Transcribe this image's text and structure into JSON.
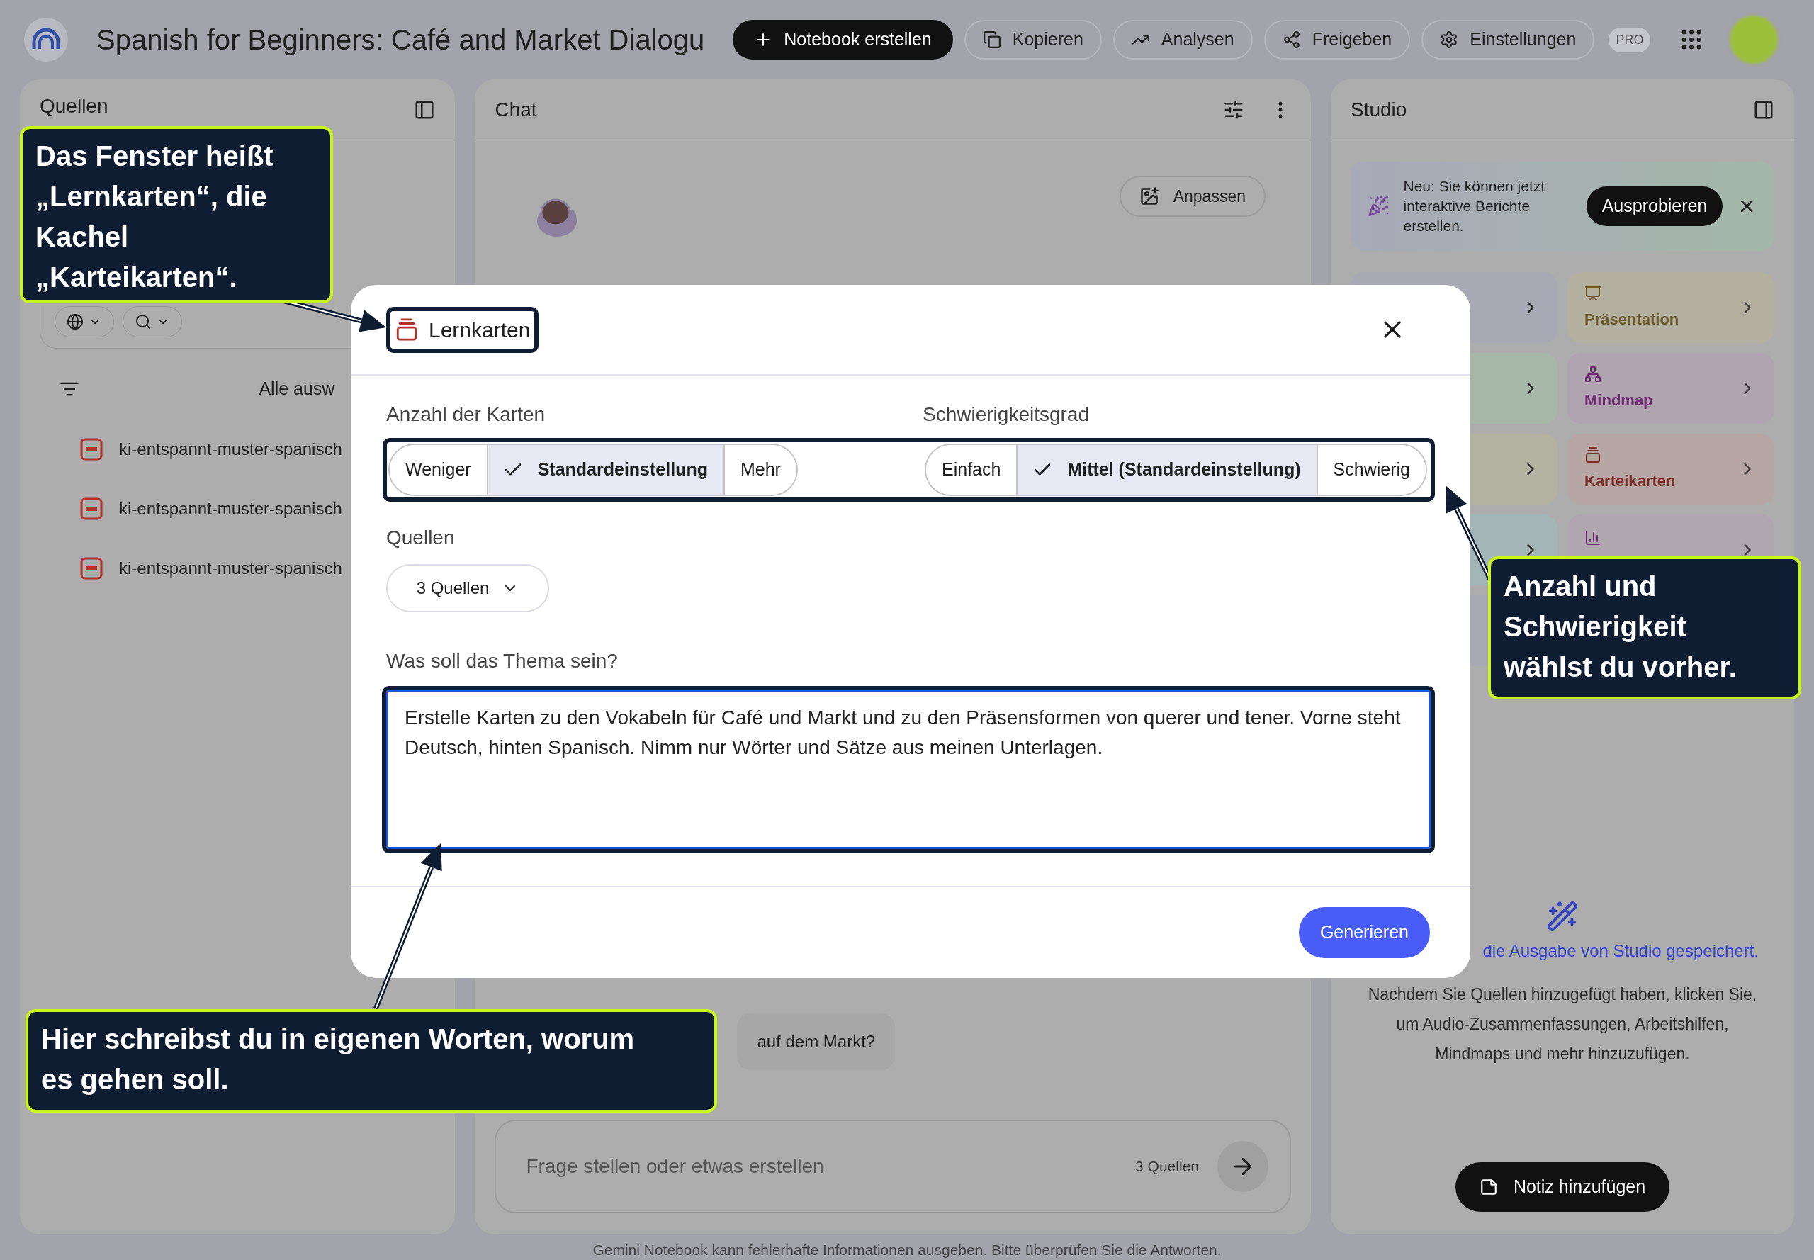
{
  "app_bar": {
    "title": "Spanish for Beginners: Café and Market Dialogu",
    "buttons": [
      {
        "label": "Notebook erstellen",
        "kind": "create"
      },
      {
        "label": "Kopieren",
        "kind": "copy"
      },
      {
        "label": "Analysen",
        "kind": "analytics"
      },
      {
        "label": "Freigeben",
        "kind": "share"
      },
      {
        "label": "Einstellungen",
        "kind": "settings"
      }
    ],
    "badge": "PRO"
  },
  "sources_panel": {
    "title": "Quellen",
    "select_all": "Alle ausw",
    "files": [
      {
        "name": "ki-entspannt-muster-spanisch"
      },
      {
        "name": "ki-entspannt-muster-spanisch"
      },
      {
        "name": "ki-entspannt-muster-spanisch"
      }
    ]
  },
  "chat_panel": {
    "title": "Chat",
    "customize_button": "Anpassen",
    "message": "auf dem Markt?",
    "input": {
      "placeholder": "Frage stellen oder etwas erstellen",
      "source_count": "3 Quellen"
    }
  },
  "studio_panel": {
    "title": "Studio",
    "banner": {
      "text": "Neu: Sie können jetzt interaktive Berichte erstellen.",
      "button": "Ausprobieren"
    },
    "tiles": [
      {
        "label": "Präsentation",
        "kind": "slides"
      },
      {
        "label": "Mindmap",
        "kind": "mindmap"
      },
      {
        "label": "Karteikarten",
        "kind": "flashcards"
      },
      {
        "kind": "chart"
      }
    ],
    "empty_state": {
      "title": "die Ausgabe von Studio gespeichert.",
      "text": "Nachdem Sie Quellen hinzugefügt haben, klicken Sie, um Audio-Zusammenfassungen, Arbeitshilfen, Mindmaps und mehr hinzuzufügen."
    },
    "note_button": "Notiz hinzufügen"
  },
  "dialog": {
    "title": "Lernkarten",
    "groups": [
      {
        "label": "Anzahl der Karten",
        "options": [
          {
            "label": "Weniger",
            "selected": false
          },
          {
            "label": "Standardeinstellung",
            "selected": true
          },
          {
            "label": "Mehr",
            "selected": false
          }
        ]
      },
      {
        "label": "Schwierigkeitsgrad",
        "options": [
          {
            "label": "Einfach",
            "selected": false
          },
          {
            "label": "Mittel (Standardeinstellung)",
            "selected": true
          },
          {
            "label": "Schwierig",
            "selected": false
          }
        ]
      }
    ],
    "sources_label": "Quellen",
    "sources_dropdown": "3 Quellen",
    "topic_label": "Was soll das Thema sein?",
    "topic_value": "Erstelle Karten zu den Vokabeln für Café und Markt und zu den Präsensformen von querer und tener. Vorne steht Deutsch, hinten Spanisch. Nimm nur Wörter und Sätze aus meinen Unterlagen.",
    "generate_button": "Generieren"
  },
  "callouts": [
    {
      "text": "Das Fenster heißt „Lernkarten“, die Kachel „Karteikarten“."
    },
    {
      "text": "Anzahl und Schwierigkeit wählst du vorher."
    },
    {
      "text": "Hier schreibst du in eigenen Worten, worum es gehen soll."
    }
  ],
  "footer": "Gemini Notebook kann fehlerhafte Informationen ausgeben. Bitte überprüfen Sie die Antworten."
}
